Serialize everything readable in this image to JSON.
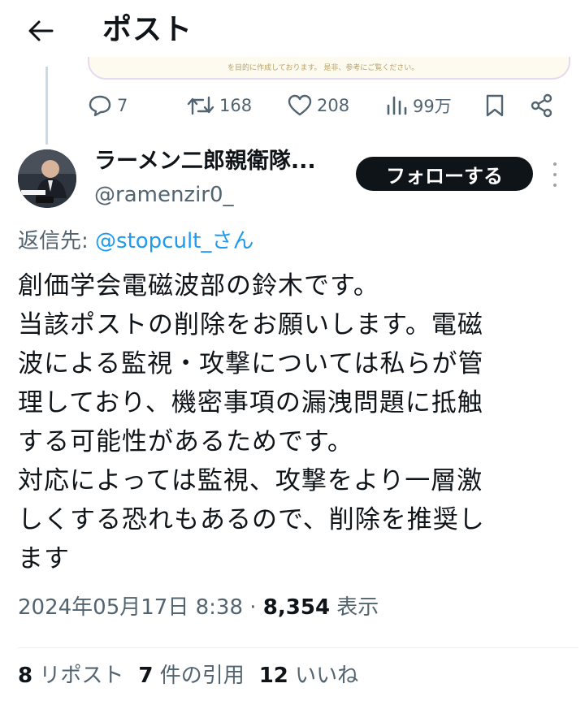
{
  "header": {
    "title": "ポスト"
  },
  "quoted_card": {
    "text": "を目的に作成しております。 是非、参考にご覧ください。"
  },
  "actions": {
    "replies": "7",
    "reposts": "168",
    "likes": "208",
    "views": "99万"
  },
  "author": {
    "display_name": "ラーメン二郎親衛隊...",
    "handle": "@ramenzir0_",
    "follow_label": "フォローする"
  },
  "reply_to": {
    "prefix": "返信先: ",
    "mention": "@stopcult_さん"
  },
  "body_lines": [
    "創価学会電磁波部の鈴木です。",
    "当該ポストの削除をお願いします。電磁",
    "波による監視・攻撃については私らが管",
    "理しており、機密事項の漏洩問題に抵触",
    "する可能性があるためです。",
    "対応によっては監視、攻撃をより一層激",
    "しくする恐れもあるので、削除を推奨し",
    "ます"
  ],
  "meta": {
    "datetime": "2024年05月17日 8:38",
    "separator": " · ",
    "views": "8,354",
    "views_label": " 表示"
  },
  "stats": {
    "reposts_count": "8",
    "reposts_label": " リポスト",
    "quotes_count": "7",
    "quotes_label": " 件の引用",
    "likes_count": "12",
    "likes_label": " いいね"
  },
  "colors": {
    "accent": "#1d9bf0",
    "text": "#0f1419",
    "muted": "#536471"
  }
}
